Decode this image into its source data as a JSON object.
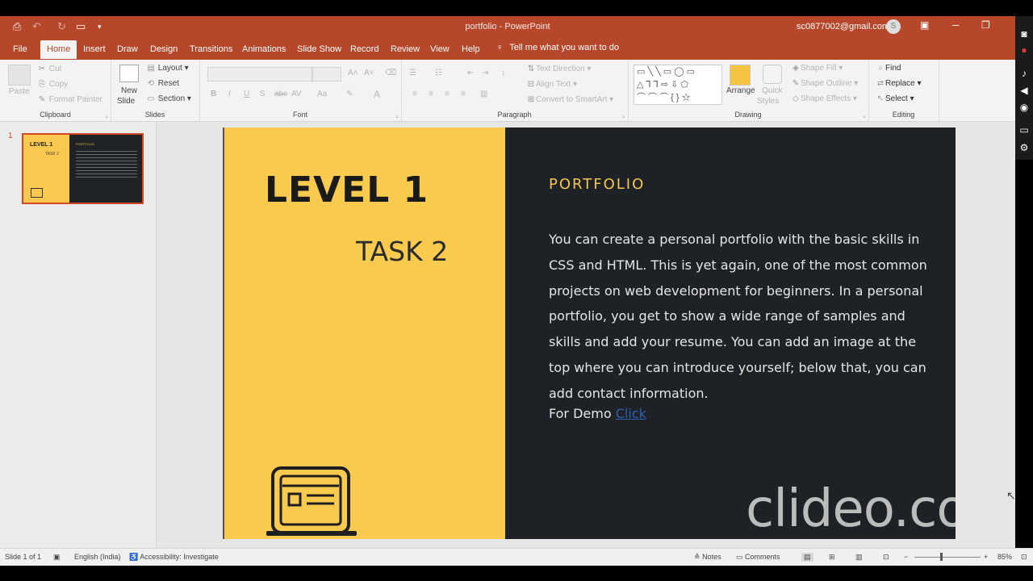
{
  "titlebar": {
    "doc_title": "portfolio  -  PowerPoint",
    "account_email": "sc0877002@gmail.com",
    "avatar_initial": "S"
  },
  "tabs": [
    "File",
    "Home",
    "Insert",
    "Draw",
    "Design",
    "Transitions",
    "Animations",
    "Slide Show",
    "Record",
    "Review",
    "View",
    "Help"
  ],
  "tell_me": "Tell me what you want to do",
  "ribbon": {
    "clipboard": {
      "label": "Clipboard",
      "paste": "Paste",
      "cut": "Cut",
      "copy": "Copy",
      "format_painter": "Format Painter"
    },
    "slides": {
      "label": "Slides",
      "new_slide": "New",
      "new_slide_2": "Slide",
      "layout": "Layout",
      "reset": "Reset",
      "section": "Section"
    },
    "font": {
      "label": "Font"
    },
    "paragraph": {
      "label": "Paragraph",
      "text_direction": "Text Direction",
      "align_text": "Align Text",
      "convert_smartart": "Convert to SmartArt"
    },
    "drawing": {
      "label": "Drawing",
      "arrange": "Arrange",
      "quick_styles": "Quick",
      "quick_styles_2": "Styles",
      "shape_fill": "Shape Fill",
      "shape_outline": "Shape Outline",
      "shape_effects": "Shape Effects"
    },
    "editing": {
      "label": "Editing",
      "find": "Find",
      "replace": "Replace",
      "select": "Select"
    }
  },
  "thumbnail": {
    "number": "1",
    "title": "LEVEL 1",
    "subtitle": "TASK 2",
    "heading": "PORTFOLIO"
  },
  "slide": {
    "title": "LEVEL 1",
    "subtitle": "TASK 2",
    "section_title": "PORTFOLIO",
    "body": "You can create a personal portfolio with the basic skills in CSS and HTML. This is yet again, one of the most common projects on web development for beginners. In a personal portfolio, you get to show a wide range of samples and skills and add your resume. You can add an image at the top where you can introduce yourself; below that, you can add contact information.",
    "demo_prefix": "For Demo ",
    "demo_link": "Click",
    "watermark": "clideo.com"
  },
  "statusbar": {
    "slide_info": "Slide 1 of 1",
    "language": "English (India)",
    "accessibility": "Accessibility: Investigate",
    "notes": "Notes",
    "comments": "Comments",
    "zoom": "85%"
  },
  "colors": {
    "accent": "#b7472a",
    "slide_yellow": "#f8cb4f",
    "slide_dark": "#1e2226",
    "link": "#2f5fb3"
  }
}
